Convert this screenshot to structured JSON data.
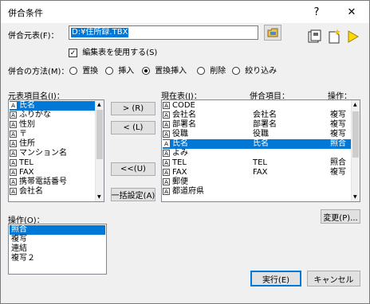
{
  "window": {
    "title": "併合条件",
    "help": "?",
    "close": "✕"
  },
  "source_table": {
    "label": "併合元表(F)：",
    "value": "D:¥住所録.TBX"
  },
  "editor_checkbox": {
    "label": "編集表を使用する(S)",
    "checked": "✓"
  },
  "merge_method": {
    "label": "併合の方法(M)：",
    "options": [
      "置換",
      "挿入",
      "置換挿入",
      "削除",
      "絞り込み"
    ],
    "selected": "置換挿入"
  },
  "source_items": {
    "label": "元表項目名(I)：",
    "items": [
      "氏名",
      "ふりがな",
      "性別",
      "〒",
      "住所",
      "マンション名",
      "TEL",
      "FAX",
      "携帯電話番号",
      "会社名"
    ],
    "selected": "氏名"
  },
  "buttons": {
    "add": "> (R)",
    "remove": "< (L)",
    "remove_all": "<<(U)",
    "bulk_set": "一括設定(A)",
    "change": "変更(P)...",
    "run": "実行(E)",
    "cancel": "キャンセル"
  },
  "current_table": {
    "label": "現在表(J)：",
    "col_merge": "併合項目：",
    "col_op": "操作：",
    "rows": [
      {
        "name": "CODE",
        "merge": "",
        "op": ""
      },
      {
        "name": "会社名",
        "merge": "会社名",
        "op": "複写"
      },
      {
        "name": "部署名",
        "merge": "部署名",
        "op": "複写"
      },
      {
        "name": "役職",
        "merge": "役職",
        "op": "複写"
      },
      {
        "name": "氏名",
        "merge": "氏名",
        "op": "照合"
      },
      {
        "name": "よみ",
        "merge": "",
        "op": ""
      },
      {
        "name": "TEL",
        "merge": "TEL",
        "op": "照合"
      },
      {
        "name": "FAX",
        "merge": "FAX",
        "op": "複写"
      },
      {
        "name": "郵便",
        "merge": "",
        "op": ""
      },
      {
        "name": "都道府県",
        "merge": "",
        "op": ""
      }
    ],
    "selected": "氏名"
  },
  "operation": {
    "label": "操作(O)：",
    "items": [
      "照合",
      "複写",
      "連結",
      "複写２"
    ],
    "selected": "照合"
  },
  "icons": [
    "folder-icon",
    "save-settings-icon",
    "load-settings-icon",
    "run-triangle-icon"
  ]
}
